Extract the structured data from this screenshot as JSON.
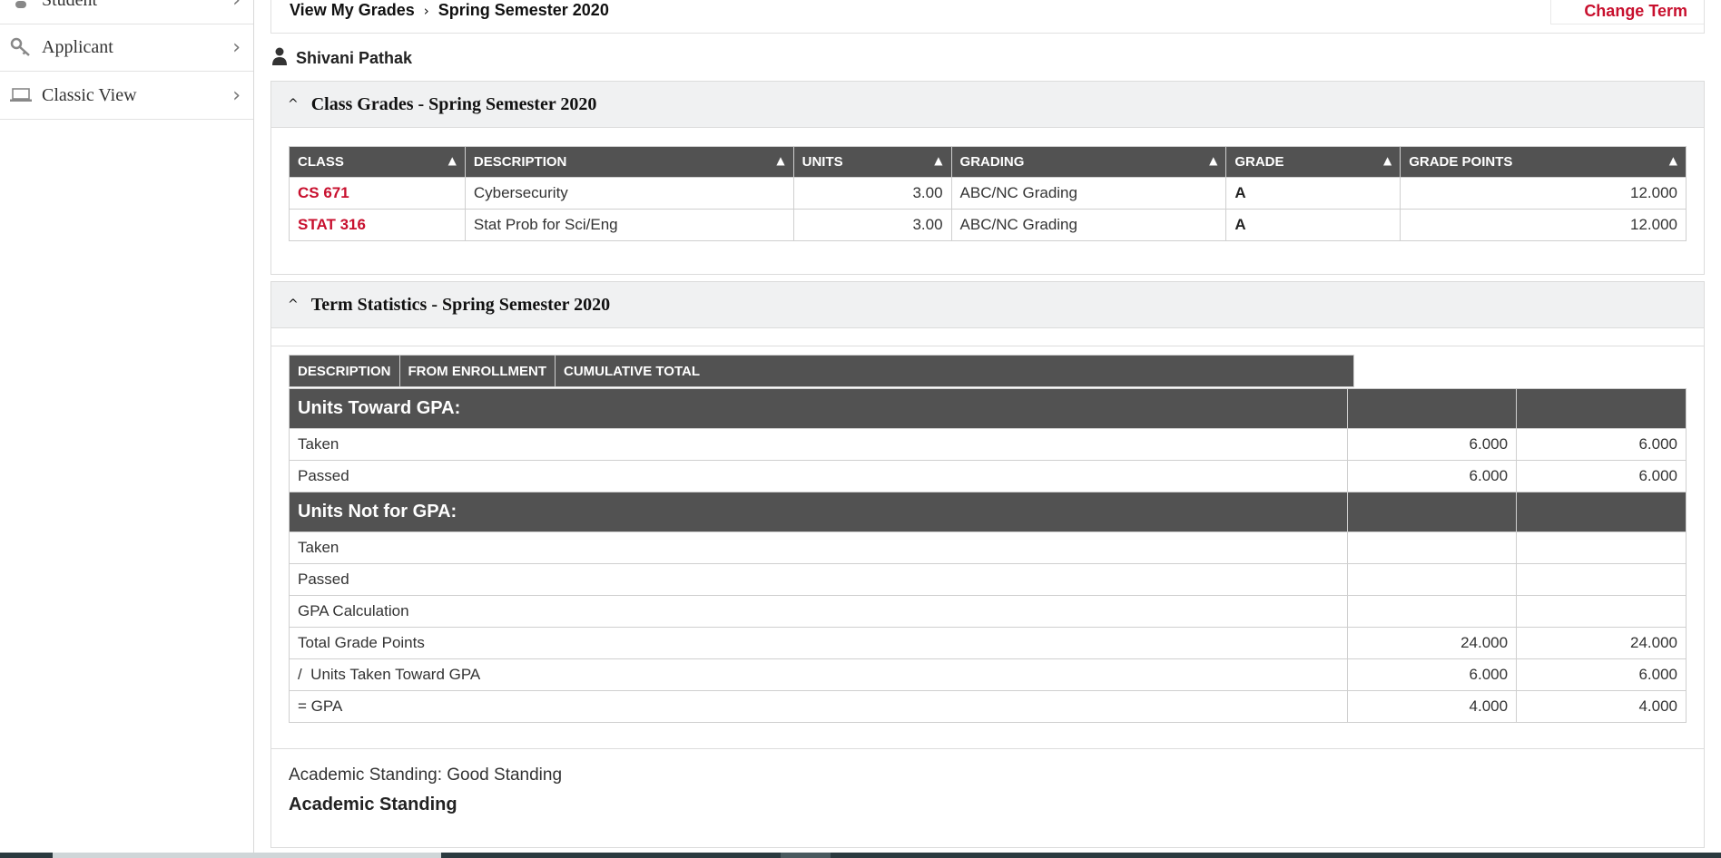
{
  "sidebar": {
    "items": [
      {
        "label": "Student",
        "icon": "person-icon"
      },
      {
        "label": "Applicant",
        "icon": "key-icon"
      },
      {
        "label": "Classic View",
        "icon": "laptop-icon"
      }
    ]
  },
  "header": {
    "breadcrumb_root": "View My Grades",
    "breadcrumb_current": "Spring Semester 2020",
    "change_term": "Change Term"
  },
  "student": {
    "name": "Shivani Pathak"
  },
  "class_grades": {
    "title": "Class Grades - Spring Semester 2020",
    "columns": [
      "CLASS",
      "DESCRIPTION",
      "UNITS",
      "GRADING",
      "GRADE",
      "GRADE POINTS"
    ],
    "rows": [
      {
        "class": "CS 671",
        "description": "Cybersecurity",
        "units": "3.00",
        "grading": "ABC/NC Grading",
        "grade": "A",
        "grade_points": "12.000"
      },
      {
        "class": "STAT 316",
        "description": "Stat Prob for Sci/Eng",
        "units": "3.00",
        "grading": "ABC/NC Grading",
        "grade": "A",
        "grade_points": "12.000"
      }
    ]
  },
  "term_statistics": {
    "title": "Term Statistics - Spring Semester 2020",
    "columns": [
      "DESCRIPTION",
      "FROM ENROLLMENT",
      "CUMULATIVE TOTAL"
    ],
    "groups": [
      {
        "label": "Units Toward GPA:",
        "rows": [
          {
            "label": "Taken",
            "from_enrollment": "6.000",
            "cumulative": "6.000"
          },
          {
            "label": "Passed",
            "from_enrollment": "6.000",
            "cumulative": "6.000"
          }
        ]
      },
      {
        "label": "Units Not for GPA:",
        "rows": [
          {
            "label": "Taken",
            "from_enrollment": "",
            "cumulative": ""
          },
          {
            "label": "Passed",
            "from_enrollment": "",
            "cumulative": ""
          },
          {
            "label": "GPA Calculation",
            "from_enrollment": "",
            "cumulative": ""
          },
          {
            "label": "Total Grade Points",
            "from_enrollment": "24.000",
            "cumulative": "24.000"
          },
          {
            "label": "/  Units Taken Toward GPA",
            "from_enrollment": "6.000",
            "cumulative": "6.000"
          },
          {
            "label": "= GPA",
            "from_enrollment": "4.000",
            "cumulative": "4.000"
          }
        ]
      }
    ]
  },
  "standing": {
    "line": "Academic Standing: Good Standing",
    "title": "Academic Standing"
  },
  "colors": {
    "accent": "#c8102e",
    "table_header": "#525252",
    "panel_header": "#f0f1f2"
  }
}
